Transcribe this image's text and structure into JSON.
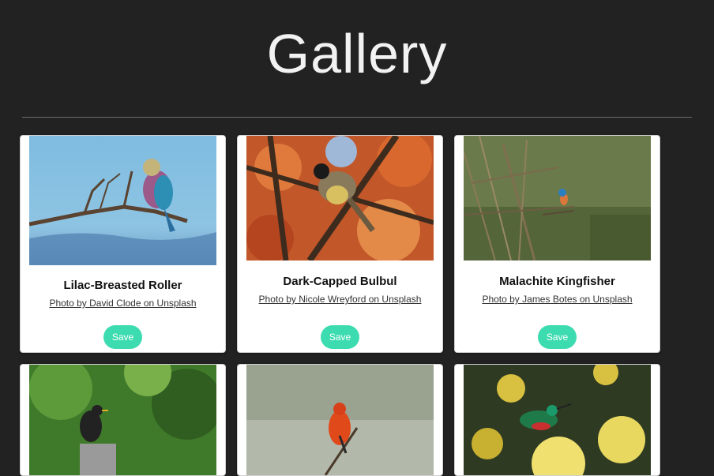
{
  "header": {
    "title": "Gallery"
  },
  "cards": [
    {
      "title": "Lilac-Breasted Roller",
      "credit": "Photo by David Clode on Unsplash",
      "save_label": "Save"
    },
    {
      "title": "Dark-Capped Bulbul",
      "credit": "Photo by Nicole Wreyford on Unsplash",
      "save_label": "Save"
    },
    {
      "title": "Malachite Kingfisher",
      "credit": "Photo by James Botes on Unsplash",
      "save_label": "Save"
    }
  ],
  "colors": {
    "background": "#222222",
    "accent": "#3ddcb0",
    "card": "#ffffff"
  }
}
